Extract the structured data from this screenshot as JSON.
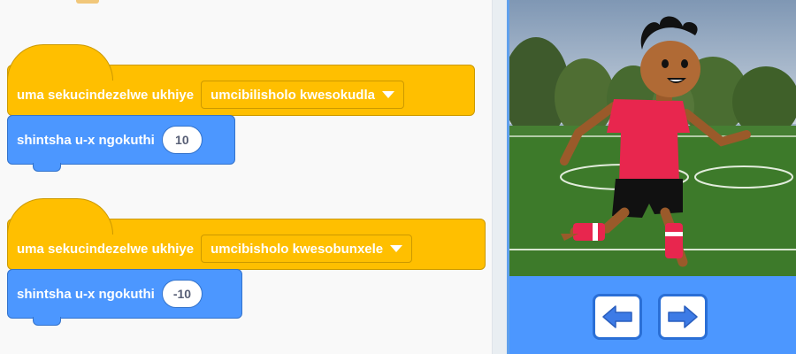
{
  "scripts": [
    {
      "hat": {
        "label": "uma sekucindezelwe ukhiye",
        "key": "umcibilisholo kwesokudla"
      },
      "motion": {
        "label": "shintsha u-x ngokuthi",
        "value": "10"
      }
    },
    {
      "hat": {
        "label": "uma sekucindezelwe ukhiye",
        "key": "umcibisholo kwesobunxele"
      },
      "motion": {
        "label": "shintsha u-x ngokuthi",
        "value": "-10"
      }
    }
  ],
  "stage": {
    "backdrop": "soccer-field",
    "sprite": "soccer-player"
  },
  "controls": {
    "left_icon": "arrow-left-icon",
    "right_icon": "arrow-right-icon"
  },
  "colors": {
    "events": "#ffbf00",
    "motion": "#4c97ff",
    "accent": "#4c97ff"
  }
}
